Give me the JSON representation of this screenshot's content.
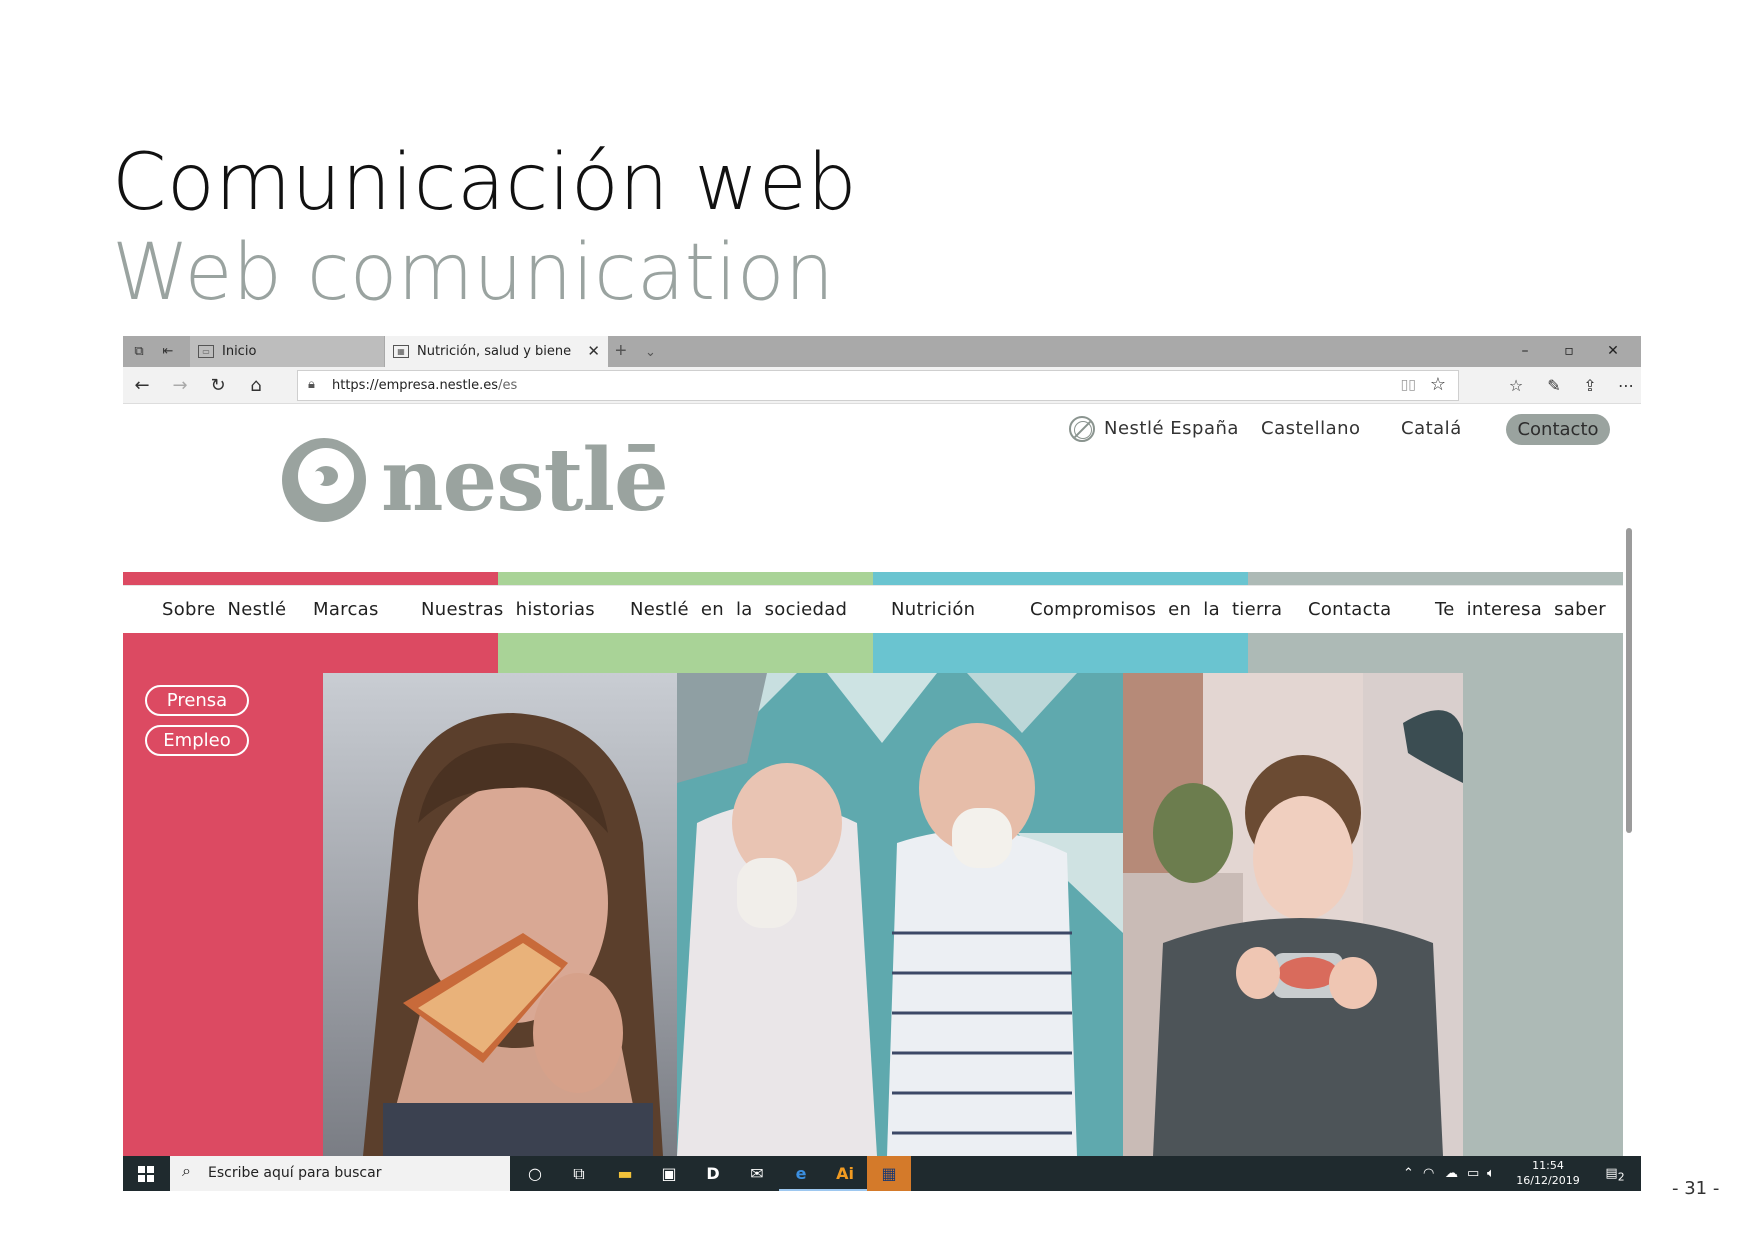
{
  "slide": {
    "title_es": "Comunicación web",
    "title_en": "Web comunication",
    "page_number": "- 31 -"
  },
  "browser": {
    "tabs": [
      {
        "label": "Inicio",
        "active": false
      },
      {
        "label": "Nutrición, salud y biene",
        "active": true
      }
    ],
    "url_host": "https://empresa.nestle.es",
    "url_path": "/es",
    "window_controls": [
      "–",
      "▫",
      "✕"
    ]
  },
  "site": {
    "logo_text": "nestlē",
    "utility_nav": {
      "country": "Nestlé España",
      "lang_es": "Castellano",
      "lang_ca": "Catalá",
      "contact": "Contacto"
    },
    "menu": [
      "Sobre Nestlé",
      "Marcas",
      "Nuestras historias",
      "Nestlé en la sociedad",
      "Nutrición",
      "Compromisos en la tierra",
      "Contacta",
      "Te interesa saber"
    ],
    "side_buttons": [
      "Prensa",
      "Empleo"
    ],
    "colors": {
      "pink": "#dc4a62",
      "green": "#a9d397",
      "teal": "#6ac4d0",
      "gray": "#adbab6",
      "logo": "#9aa39f"
    }
  },
  "taskbar": {
    "search_placeholder": "Escribe aquí para buscar",
    "time": "11:54",
    "date": "16/12/2019",
    "notifications": "2",
    "apps": [
      "cortana-icon",
      "task-view-icon",
      "file-explorer-icon",
      "store-icon",
      "dash-app-icon",
      "mail-icon",
      "edge-icon",
      "illustrator-icon",
      "photo-app-icon"
    ]
  }
}
